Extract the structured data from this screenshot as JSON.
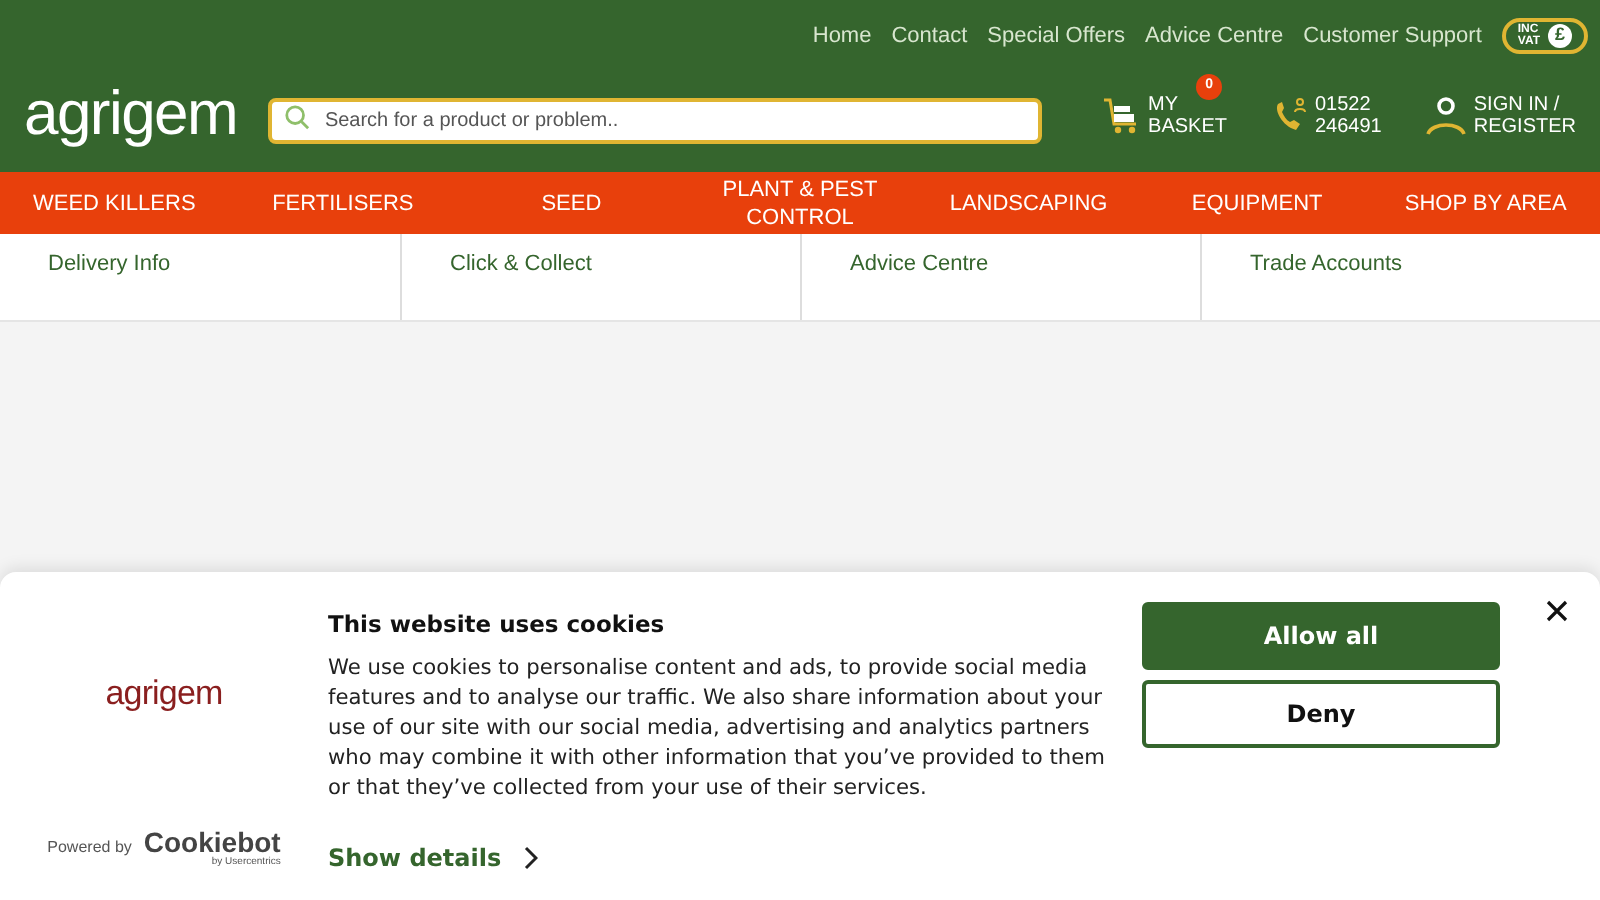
{
  "top_links": [
    "Home",
    "Contact",
    "Special Offers",
    "Advice Centre",
    "Customer Support"
  ],
  "vat_toggle": {
    "label_line1": "INC",
    "label_line2": "VAT",
    "symbol": "£",
    "on": true
  },
  "logo": {
    "text": "agrigem"
  },
  "search": {
    "placeholder": "Search for a product or problem.."
  },
  "basket": {
    "line1": "MY",
    "line2": "BASKET",
    "count": "0"
  },
  "phone": {
    "line1": "01522",
    "line2": "246491"
  },
  "account": {
    "line1": "SIGN IN /",
    "line2": "REGISTER"
  },
  "main_nav": [
    "WEED KILLERS",
    "FERTILISERS",
    "SEED",
    "PLANT & PEST CONTROL",
    "LANDSCAPING",
    "EQUIPMENT",
    "SHOP BY AREA"
  ],
  "sub_nav": [
    "Delivery Info",
    "Click & Collect",
    "Advice Centre",
    "Trade Accounts"
  ],
  "cookie_banner": {
    "logo_text": "agrigem",
    "powered_by": "Powered by",
    "brand": "Cookiebot",
    "brand_sub": "by Usercentrics",
    "title": "This website uses cookies",
    "body": "We use cookies to personalise content and ads, to provide social media features and to analyse our traffic. We also share information about your use of our site with our social media, advertising and analytics partners who may combine it with other information that you’ve provided to them or that they’ve collected from your use of their services.",
    "details_link": "Show details",
    "buttons": [
      {
        "label": "Allow all",
        "kind": "primary"
      },
      {
        "label": "Deny",
        "kind": "outline"
      }
    ]
  }
}
